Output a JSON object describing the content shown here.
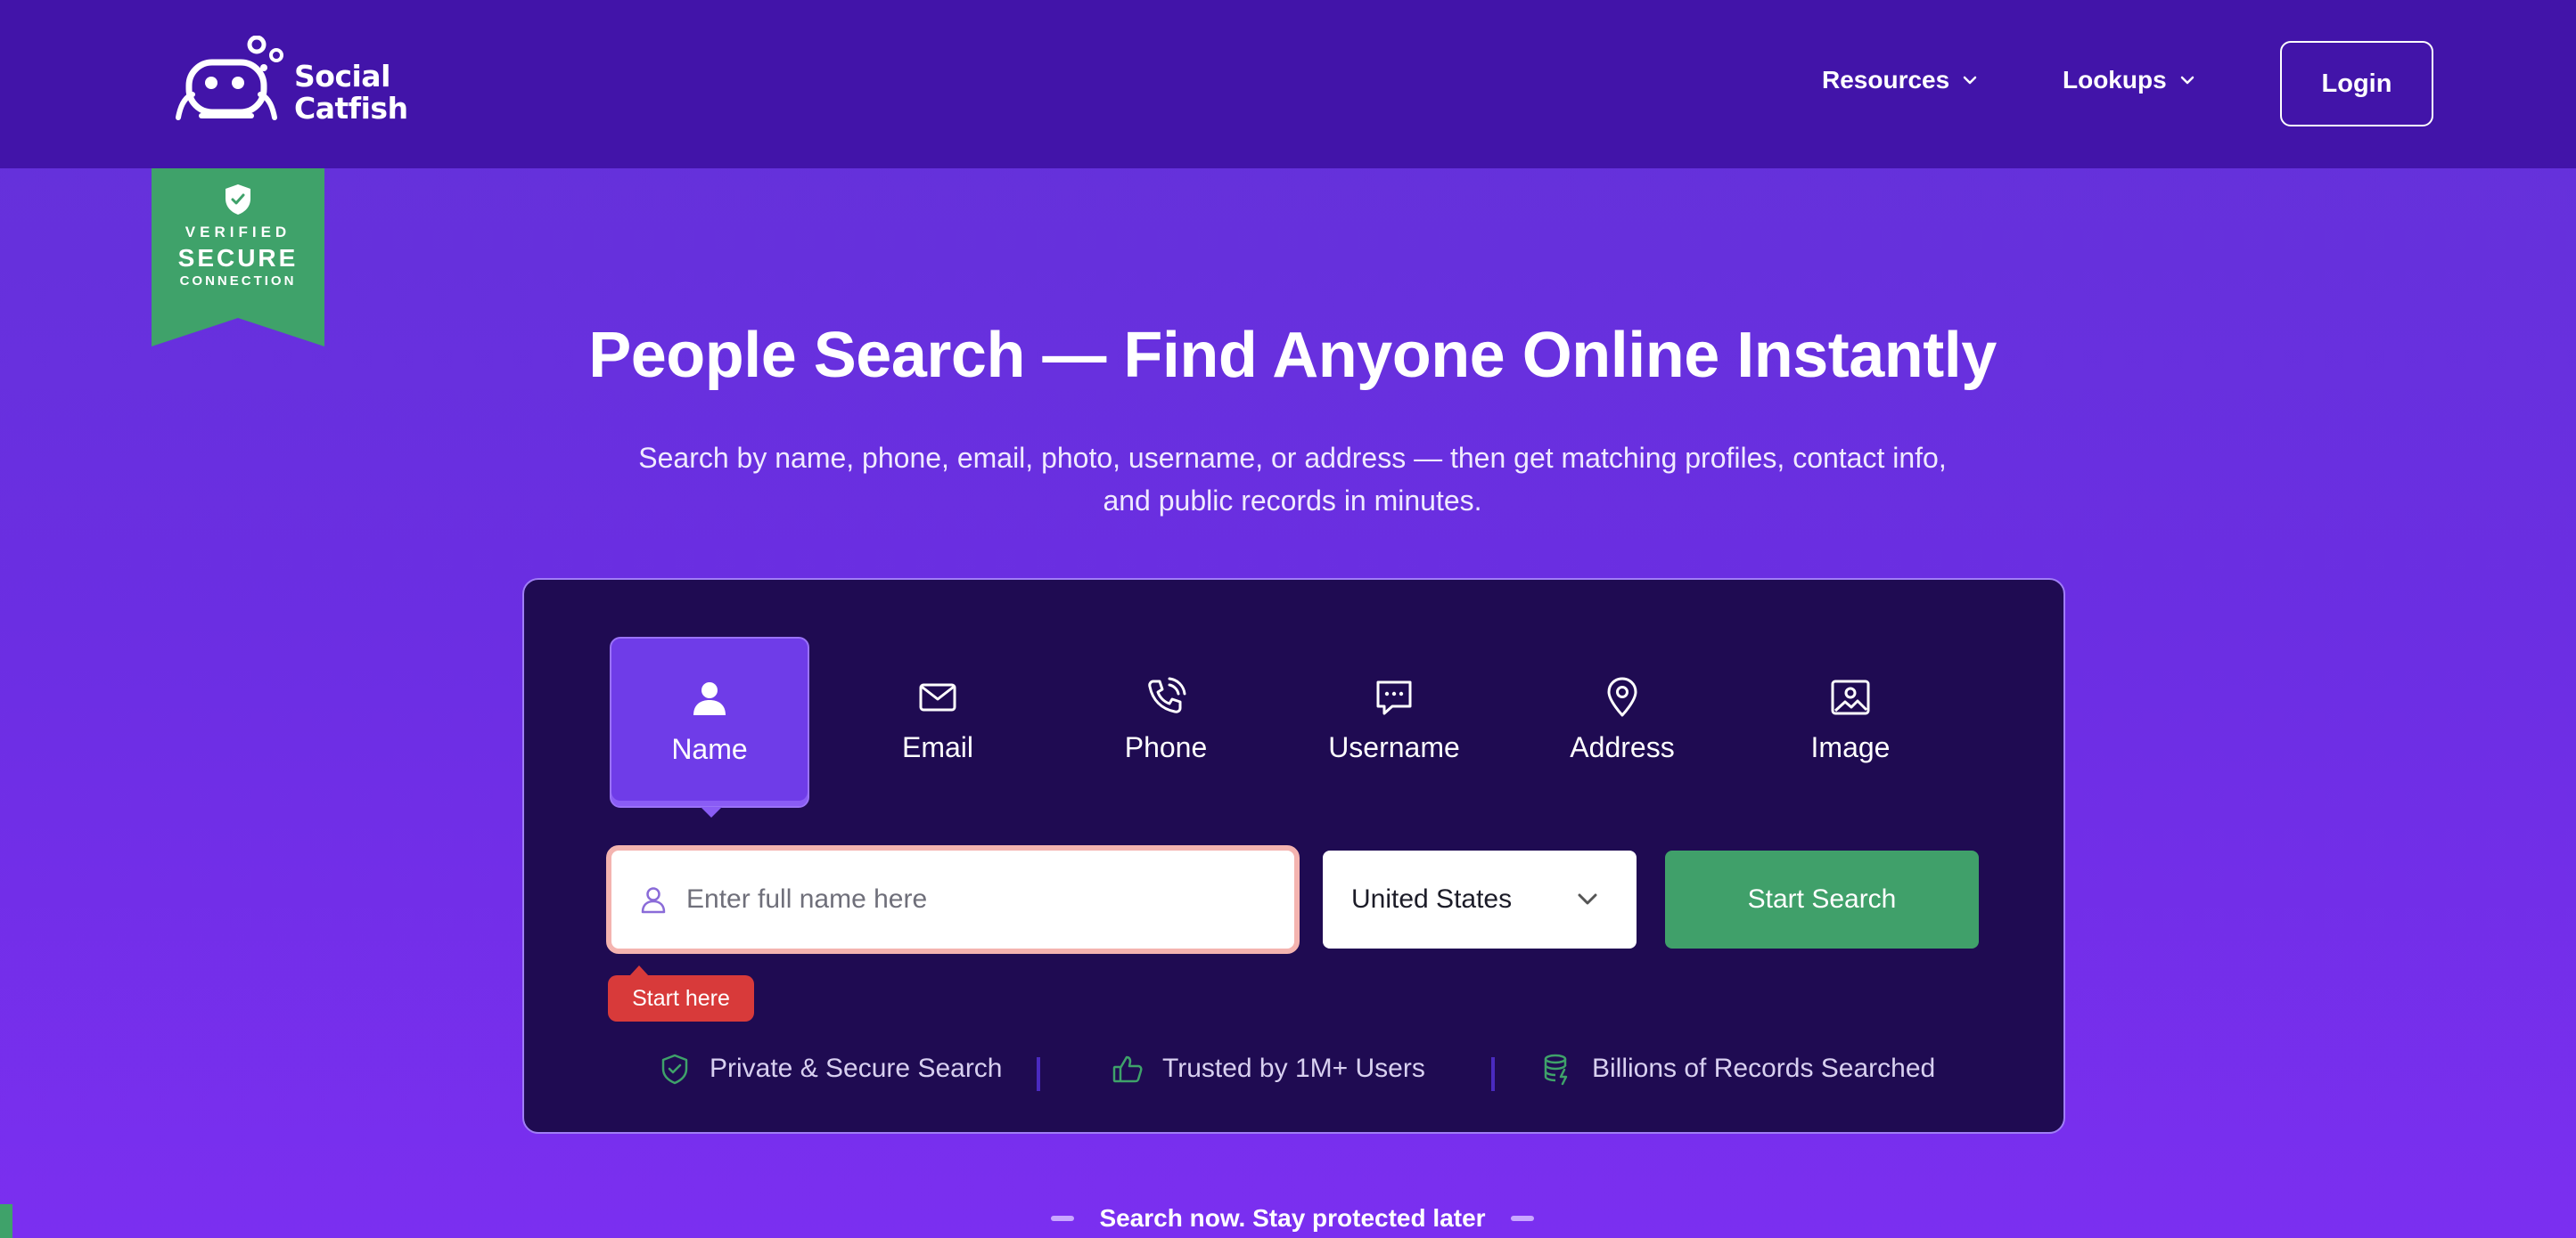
{
  "header": {
    "logo_line1": "Social",
    "logo_line2": "Catfish",
    "nav": [
      {
        "label": "Resources",
        "icon": "chevron-down-icon"
      },
      {
        "label": "Lookups",
        "icon": "chevron-down-icon"
      }
    ],
    "login_label": "Login"
  },
  "badge": {
    "line1": "VERIFIED",
    "line2": "SECURE",
    "line3": "CONNECTION",
    "color": "#3fa26a"
  },
  "hero": {
    "title": "People Search — Find Anyone Online Instantly",
    "subtitle_line1": "Search by name, phone, email, photo, username, or address — then get matching profiles, contact info,",
    "subtitle_line2": "and public records in minutes."
  },
  "search": {
    "tabs": [
      {
        "label": "Name",
        "icon": "person-icon",
        "active": true
      },
      {
        "label": "Email",
        "icon": "envelope-icon",
        "active": false
      },
      {
        "label": "Phone",
        "icon": "phone-icon",
        "active": false
      },
      {
        "label": "Username",
        "icon": "chat-icon",
        "active": false
      },
      {
        "label": "Address",
        "icon": "map-pin-icon",
        "active": false
      },
      {
        "label": "Image",
        "icon": "image-icon",
        "active": false
      }
    ],
    "input_placeholder": "Enter full name here",
    "country_selected": "United States",
    "submit_label": "Start Search",
    "tooltip": "Start here",
    "trust": [
      {
        "label": "Private & Secure Search",
        "icon": "shield-check-icon"
      },
      {
        "label": "Trusted by 1M+ Users",
        "icon": "thumbs-up-icon"
      },
      {
        "label": "Billions of Records Searched",
        "icon": "database-icon"
      }
    ]
  },
  "tagline": "Search now. Stay protected later",
  "colors": {
    "header_bg": "#4214a9",
    "panel_bg": "#1f0b52",
    "accent_green": "#40a06a",
    "tab_active": "#6f3ce8",
    "tooltip_red": "#d83a3a"
  }
}
